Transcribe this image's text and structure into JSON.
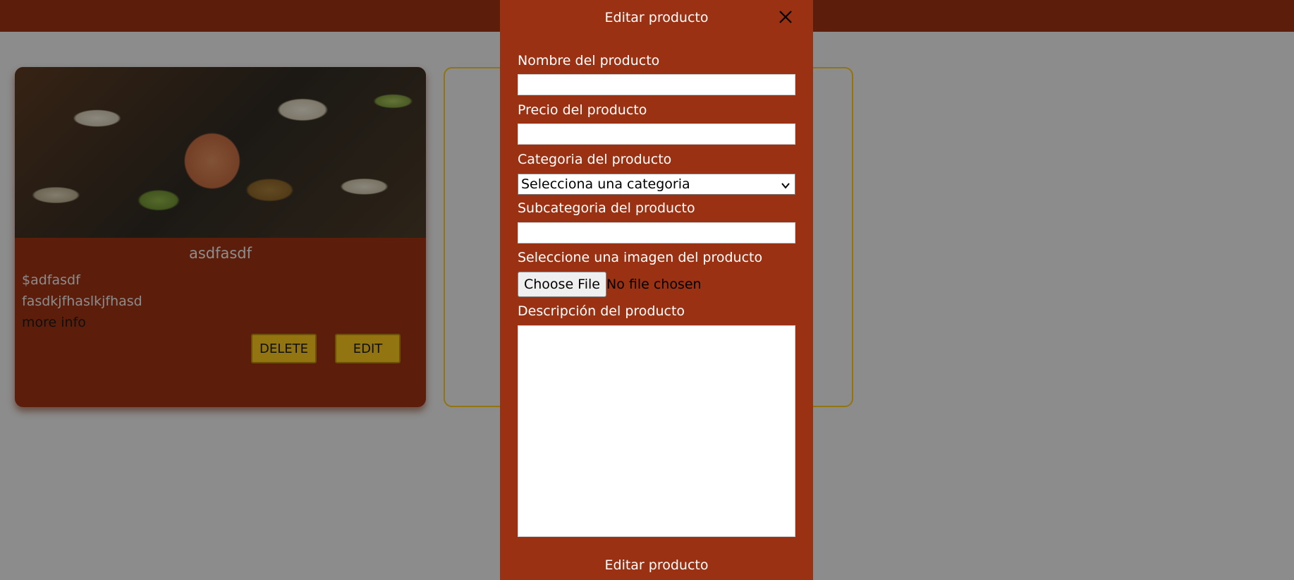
{
  "card": {
    "title": "asdfasdf",
    "price": "$adfasdf",
    "description": "fasdkjfhaslkjfhasd",
    "more_info": "more info",
    "delete_label": "DELETE",
    "edit_label": "EDIT",
    "image_icon": "sushi-photo"
  },
  "modal": {
    "title": "Editar producto",
    "close_icon": "close-icon",
    "fields": {
      "name_label": "Nombre del producto",
      "name_value": "",
      "price_label": "Precio del producto",
      "price_value": "",
      "category_label": "Categoria del producto",
      "category_selected": "Selecciona una categoria",
      "subcategory_label": "Subcategoria del producto",
      "subcategory_value": "",
      "image_label": "Seleccione una imagen del producto",
      "choose_file_label": "Choose File",
      "file_status": "No file chosen",
      "description_label": "Descripción del producto",
      "description_value": ""
    },
    "submit_label": "Editar producto"
  },
  "colors": {
    "brand": "#9b3113",
    "accent": "#f3c21b",
    "background": "#e9e9e9"
  }
}
